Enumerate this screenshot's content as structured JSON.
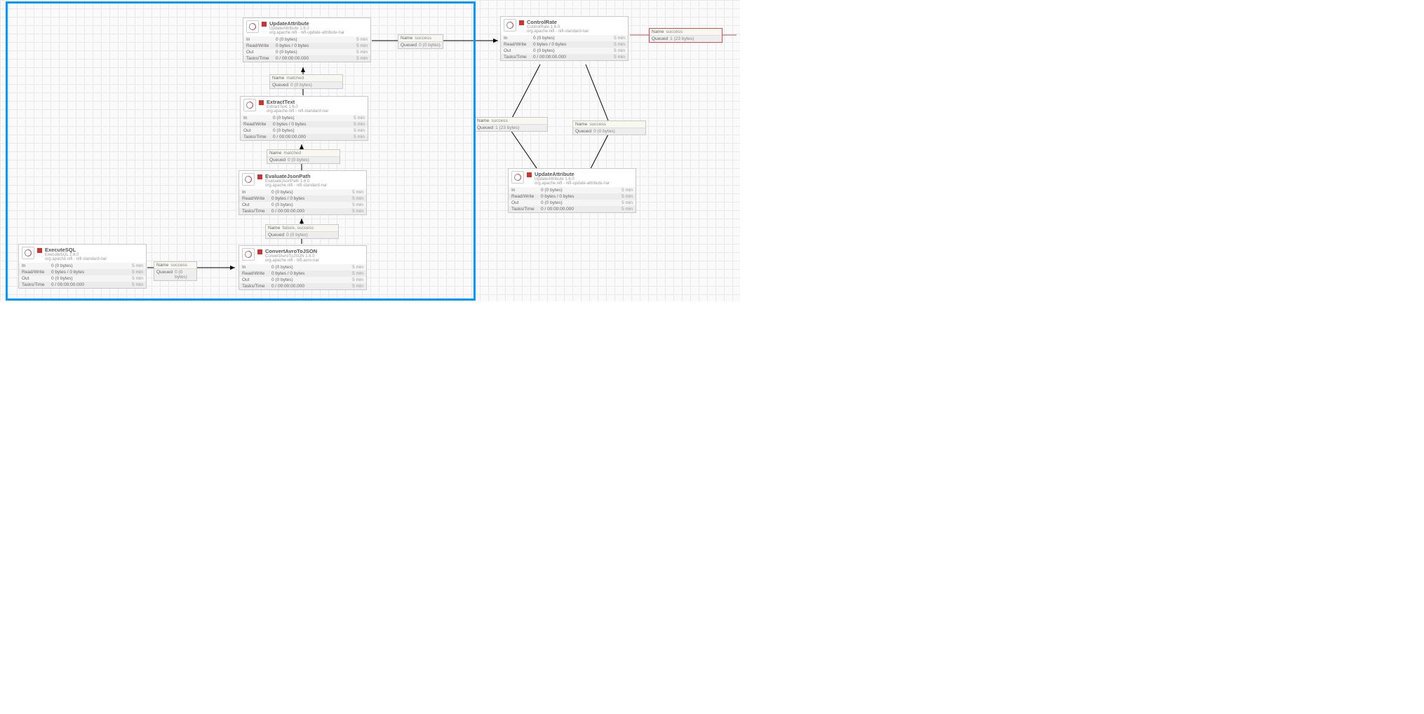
{
  "labels": {
    "in": "In",
    "rw": "Read/Write",
    "out": "Out",
    "tt": "Tasks/Time",
    "name": "Name",
    "queued": "Queued",
    "fivemin": "5 min"
  },
  "processors": {
    "executeSql": {
      "name": "ExecuteSQL",
      "type": "ExecuteSQL 1.6.0",
      "bundle": "org.apache.nifi - nifi-standard-nar",
      "in": "0 (0 bytes)",
      "rw": "0 bytes / 0 bytes",
      "out": "0 (0 bytes)",
      "tt": "0 / 00:00:00.000"
    },
    "convertAvro": {
      "name": "ConvertAvroToJSON",
      "type": "ConvertAvroToJSON 1.6.0",
      "bundle": "org.apache.nifi - nifi-avro-nar",
      "in": "0 (0 bytes)",
      "rw": "0 bytes / 0 bytes",
      "out": "0 (0 bytes)",
      "tt": "0 / 00:00:00.000"
    },
    "evalJson": {
      "name": "EvaluateJsonPath",
      "type": "EvaluateJsonPath 1.6.0",
      "bundle": "org.apache.nifi - nifi-standard-nar",
      "in": "0 (0 bytes)",
      "rw": "0 bytes / 0 bytes",
      "out": "0 (0 bytes)",
      "tt": "0 / 00:00:00.000"
    },
    "extractText": {
      "name": "ExtractText",
      "type": "ExtractText 1.6.0",
      "bundle": "org.apache.nifi - nifi-standard-nar",
      "in": "0 (0 bytes)",
      "rw": "0 bytes / 0 bytes",
      "out": "0 (0 bytes)",
      "tt": "0 / 00:00:00.000"
    },
    "updateAttr1": {
      "name": "UpdateAttribute",
      "type": "UpdateAttribute 1.6.0",
      "bundle": "org.apache.nifi - nifi-update-attribute-nar",
      "in": "0 (0 bytes)",
      "rw": "0 bytes / 0 bytes",
      "out": "0 (0 bytes)",
      "tt": "0 / 00:00:00.000"
    },
    "controlRate": {
      "name": "ControlRate",
      "type": "ControlRate 1.6.0",
      "bundle": "org.apache.nifi - nifi-standard-nar",
      "in": "0 (0 bytes)",
      "rw": "0 bytes / 0 bytes",
      "out": "0 (0 bytes)",
      "tt": "0 / 00:00:00.000"
    },
    "updateAttr2": {
      "name": "UpdateAttribute",
      "type": "UpdateAttribute 1.6.0",
      "bundle": "org.apache.nifi - nifi-update-attribute-nar",
      "in": "0 (0 bytes)",
      "rw": "0 bytes / 0 bytes",
      "out": "0 (0 bytes)",
      "tt": "0 / 00:00:00.000"
    }
  },
  "connections": {
    "execToAvro": {
      "name": "success",
      "queued": "0 (0 bytes)"
    },
    "avroToEval": {
      "name": "failure, success",
      "queued": "0 (0 bytes)"
    },
    "evalToExtract": {
      "name": "matched",
      "queued": "0 (0 bytes)"
    },
    "extractToUpdate": {
      "name": "matched",
      "queued": "0 (0 bytes)"
    },
    "updateToControl": {
      "name": "success",
      "queued": "0 (0 bytes)"
    },
    "controlToUpdate2a": {
      "name": "success",
      "queued": "1 (23 bytes)"
    },
    "controlToUpdate2b": {
      "name": "success",
      "queued": "0 (0 bytes)"
    },
    "controlOut": {
      "name": "success",
      "queued": "1 (23 bytes)"
    }
  }
}
